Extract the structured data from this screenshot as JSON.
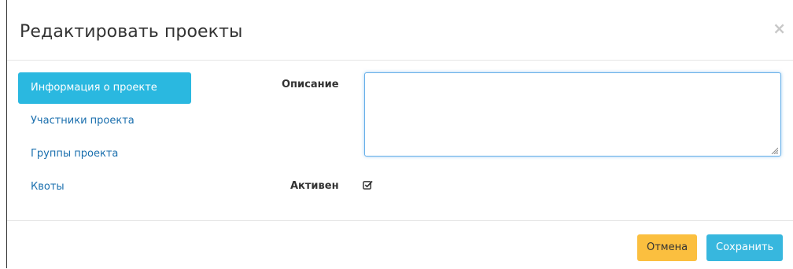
{
  "dialog": {
    "title": "Редактировать проекты",
    "close_label": "×"
  },
  "nav": {
    "items": [
      {
        "label": "Информация о проекте",
        "active": true
      },
      {
        "label": "Участники проекта",
        "active": false
      },
      {
        "label": "Группы проекта",
        "active": false
      },
      {
        "label": "Квоты",
        "active": false
      }
    ]
  },
  "form": {
    "description_label": "Описание",
    "description_value": "",
    "active_label": "Активен",
    "active_checked": true
  },
  "footer": {
    "cancel_label": "Отмена",
    "save_label": "Сохранить"
  },
  "colors": {
    "nav_active_bg": "#2ab8e0",
    "link": "#1a6fae",
    "cancel_bg": "#fbbf3f",
    "save_bg": "#37b7de"
  }
}
